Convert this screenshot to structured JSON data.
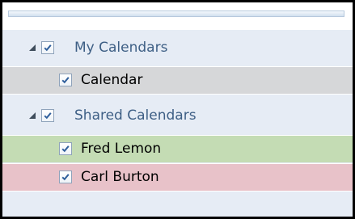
{
  "calendar_groups": [
    {
      "label": "My Calendars",
      "checked": true,
      "expander": "collapse-triangle-icon",
      "items": [
        {
          "label": "Calendar",
          "checked": true,
          "row_color": "#d6d7d9"
        }
      ]
    },
    {
      "label": "Shared Calendars",
      "checked": true,
      "expander": "collapse-triangle-icon",
      "items": [
        {
          "label": "Fred Lemon",
          "checked": true,
          "row_color": "#c4dcb4"
        },
        {
          "label": "Carl Burton",
          "checked": true,
          "row_color": "#e8c2c9"
        }
      ]
    }
  ],
  "colors": {
    "group_text": "#3e5f85",
    "pane_background": "#e6ecf5",
    "check_color": "#2f5f9c"
  }
}
